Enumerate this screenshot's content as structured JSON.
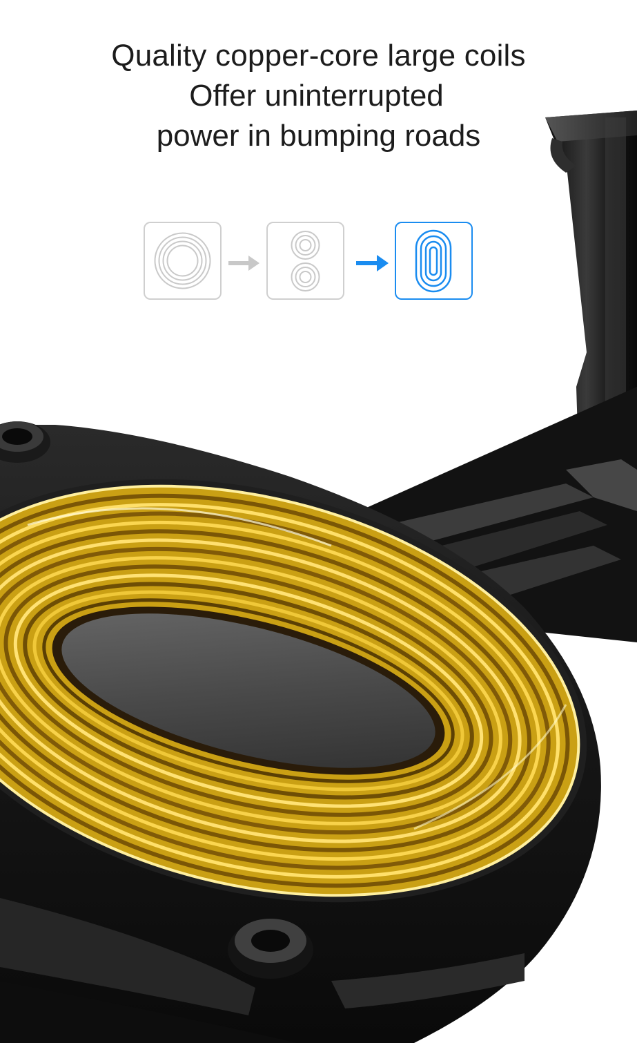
{
  "headline": {
    "line1": "Quality copper-core large coils",
    "line2": "Offer uninterrupted",
    "line3": "power in bumping roads"
  },
  "diagram": {
    "steps": [
      {
        "icon": "concentric-circle-coil-icon",
        "state": "inactive"
      },
      {
        "icon": "double-circle-coil-icon",
        "state": "inactive"
      },
      {
        "icon": "oval-coil-icon",
        "state": "active"
      }
    ],
    "arrows": [
      {
        "icon": "arrow-right-icon",
        "state": "inactive"
      },
      {
        "icon": "arrow-right-icon",
        "state": "active"
      }
    ]
  },
  "colors": {
    "background": "#ffffff",
    "text": "#1c1c1c",
    "inactive": "#c8c8c8",
    "active": "#1a8cf0",
    "copper": "#e0b21a",
    "body": "#1b1b1b"
  },
  "photo": {
    "subject": "gold-coil-charger-photo"
  }
}
